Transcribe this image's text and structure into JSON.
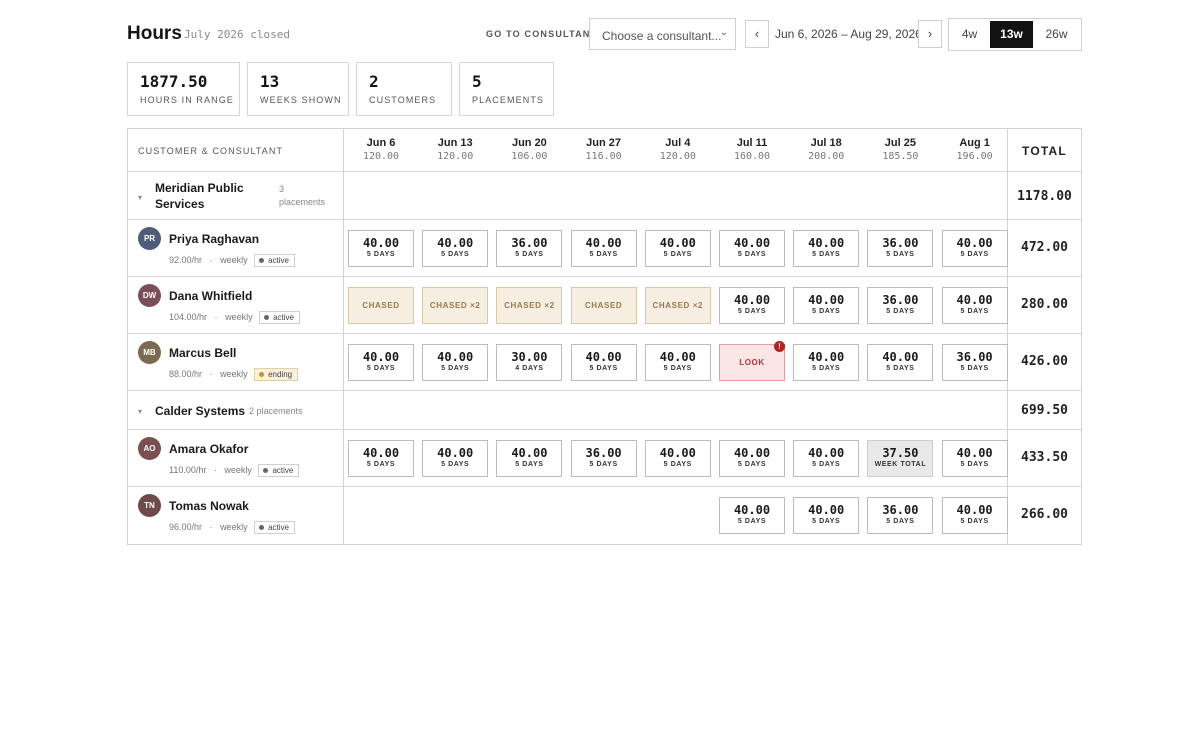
{
  "header": {
    "title": "Hours",
    "subtitle": "July 2026 closed",
    "goto_label": "GO TO CONSULTANT",
    "consultant_select": {
      "placeholder": "Choose a consultant...",
      "icon": "chevron-down-icon"
    },
    "prev": "‹",
    "next": "›",
    "date_range": "Jun 6, 2026 – Aug 29, 2026",
    "span_options": [
      {
        "label": "4w",
        "selected": false
      },
      {
        "label": "13w",
        "selected": true
      },
      {
        "label": "26w",
        "selected": false
      }
    ]
  },
  "stats": [
    {
      "value": "1877.50",
      "label": "HOURS IN RANGE"
    },
    {
      "value": "13",
      "label": "WEEKS SHOWN"
    },
    {
      "value": "2",
      "label": "CUSTOMERS"
    },
    {
      "value": "5",
      "label": "PLACEMENTS"
    }
  ],
  "table": {
    "first_col_header": "CUSTOMER & CONSULTANT",
    "total_header": "TOTAL",
    "weeks": [
      {
        "date": "Jun 6",
        "hours": "120.00"
      },
      {
        "date": "Jun 13",
        "hours": "120.00"
      },
      {
        "date": "Jun 20",
        "hours": "106.00"
      },
      {
        "date": "Jun 27",
        "hours": "116.00"
      },
      {
        "date": "Jul 4",
        "hours": "120.00"
      },
      {
        "date": "Jul 11",
        "hours": "160.00"
      },
      {
        "date": "Jul 18",
        "hours": "200.00"
      },
      {
        "date": "Jul 25",
        "hours": "185.50"
      },
      {
        "date": "Aug 1",
        "hours": "196.00"
      }
    ],
    "groups": [
      {
        "name_line1": "Meridian Public",
        "name_line2": "Services",
        "placements_line1": "3",
        "placements_line2": "placements",
        "total": "1178.00",
        "consultants": [
          {
            "initials": "PR",
            "name": "Priya Raghavan",
            "rate": "92.00/hr",
            "sep": "·",
            "cadence": "weekly",
            "status": "active",
            "avatar_color": "#4f5d7a",
            "total": "472.00",
            "cells": [
              {
                "type": "hours",
                "hours": "40.00",
                "days": "5 DAYS"
              },
              {
                "type": "hours",
                "hours": "40.00",
                "days": "5 DAYS"
              },
              {
                "type": "hours",
                "hours": "36.00",
                "days": "5 DAYS"
              },
              {
                "type": "hours",
                "hours": "40.00",
                "days": "5 DAYS"
              },
              {
                "type": "hours",
                "hours": "40.00",
                "days": "5 DAYS"
              },
              {
                "type": "hours",
                "hours": "40.00",
                "days": "5 DAYS"
              },
              {
                "type": "hours",
                "hours": "40.00",
                "days": "5 DAYS"
              },
              {
                "type": "hours",
                "hours": "36.00",
                "days": "5 DAYS"
              },
              {
                "type": "hours",
                "hours": "40.00",
                "days": "5 DAYS"
              }
            ]
          },
          {
            "initials": "DW",
            "name": "Dana Whitfield",
            "rate": "104.00/hr",
            "sep": "·",
            "cadence": "weekly",
            "status": "active",
            "avatar_color": "#7a4f5a",
            "total": "280.00",
            "cells": [
              {
                "type": "chased",
                "label": "CHASED"
              },
              {
                "type": "chased",
                "label": "CHASED ×2"
              },
              {
                "type": "chased",
                "label": "CHASED ×2"
              },
              {
                "type": "chased",
                "label": "CHASED"
              },
              {
                "type": "chased",
                "label": "CHASED ×2"
              },
              {
                "type": "hours",
                "hours": "40.00",
                "days": "5 DAYS"
              },
              {
                "type": "hours",
                "hours": "40.00",
                "days": "5 DAYS"
              },
              {
                "type": "hours",
                "hours": "36.00",
                "days": "5 DAYS"
              },
              {
                "type": "hours",
                "hours": "40.00",
                "days": "5 DAYS"
              }
            ]
          },
          {
            "initials": "MB",
            "name": "Marcus Bell",
            "rate": "88.00/hr",
            "sep": "·",
            "cadence": "weekly",
            "status": "ending",
            "avatar_color": "#7a6a4f",
            "total": "426.00",
            "cells": [
              {
                "type": "hours",
                "hours": "40.00",
                "days": "5 DAYS"
              },
              {
                "type": "hours",
                "hours": "40.00",
                "days": "5 DAYS"
              },
              {
                "type": "hours",
                "hours": "30.00",
                "days": "4 DAYS"
              },
              {
                "type": "hours",
                "hours": "40.00",
                "days": "5 DAYS"
              },
              {
                "type": "hours",
                "hours": "40.00",
                "days": "5 DAYS"
              },
              {
                "type": "look",
                "label": "LOOK",
                "alert": "!"
              },
              {
                "type": "hours",
                "hours": "40.00",
                "days": "5 DAYS"
              },
              {
                "type": "hours",
                "hours": "40.00",
                "days": "5 DAYS"
              },
              {
                "type": "hours",
                "hours": "36.00",
                "days": "5 DAYS"
              }
            ]
          }
        ]
      },
      {
        "name_line1": "Calder Systems",
        "name_line2": "",
        "placements_line1": "2 placements",
        "placements_line2": "",
        "total": "699.50",
        "consultants": [
          {
            "initials": "AO",
            "name": "Amara Okafor",
            "rate": "110.00/hr",
            "sep": "·",
            "cadence": "weekly",
            "status": "active",
            "avatar_color": "#7a4f4f",
            "total": "433.50",
            "cells": [
              {
                "type": "hours",
                "hours": "40.00",
                "days": "5 DAYS"
              },
              {
                "type": "hours",
                "hours": "40.00",
                "days": "5 DAYS"
              },
              {
                "type": "hours",
                "hours": "40.00",
                "days": "5 DAYS"
              },
              {
                "type": "hours",
                "hours": "36.00",
                "days": "5 DAYS"
              },
              {
                "type": "hours",
                "hours": "40.00",
                "days": "5 DAYS"
              },
              {
                "type": "hours",
                "hours": "40.00",
                "days": "5 DAYS"
              },
              {
                "type": "hours",
                "hours": "40.00",
                "days": "5 DAYS"
              },
              {
                "type": "weektotal",
                "hours": "37.50",
                "days": "WEEK TOTAL"
              },
              {
                "type": "hours",
                "hours": "40.00",
                "days": "5 DAYS"
              }
            ]
          },
          {
            "initials": "TN",
            "name": "Tomas Nowak",
            "rate": "96.00/hr",
            "sep": "·",
            "cadence": "weekly",
            "status": "active",
            "avatar_color": "#6e4a4a",
            "total": "266.00",
            "cells": [
              {
                "type": "empty"
              },
              {
                "type": "empty"
              },
              {
                "type": "empty"
              },
              {
                "type": "empty"
              },
              {
                "type": "empty"
              },
              {
                "type": "hours",
                "hours": "40.00",
                "days": "5 DAYS"
              },
              {
                "type": "hours",
                "hours": "40.00",
                "days": "5 DAYS"
              },
              {
                "type": "hours",
                "hours": "36.00",
                "days": "5 DAYS"
              },
              {
                "type": "hours",
                "hours": "40.00",
                "days": "5 DAYS"
              }
            ]
          }
        ]
      }
    ]
  }
}
